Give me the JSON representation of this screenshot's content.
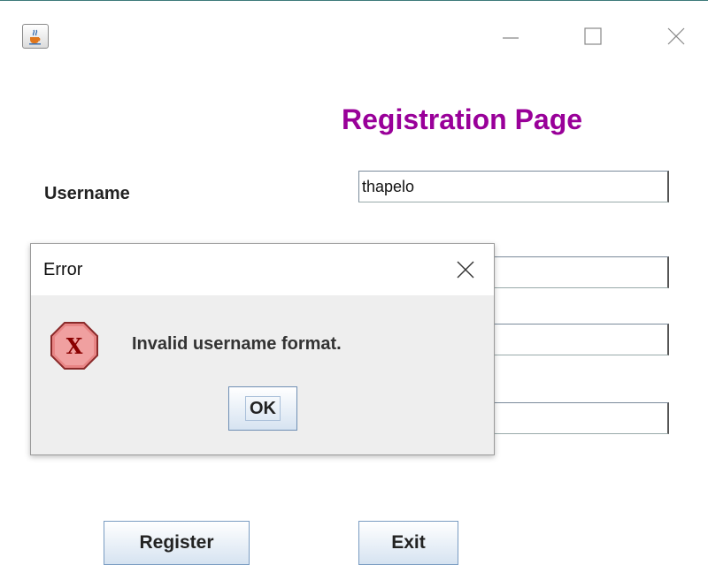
{
  "window": {
    "icon": "java-coffee-icon",
    "controls": [
      "minimize-icon",
      "maximize-icon",
      "close-icon"
    ]
  },
  "form": {
    "title": "Registration Page",
    "username_label": "Username",
    "username_value": "thapelo",
    "field2_value": "",
    "field3_value": "",
    "field4_value": "",
    "register_label": "Register",
    "exit_label": "Exit"
  },
  "dialog": {
    "title": "Error",
    "message": "Invalid username format.",
    "ok_label": "OK",
    "icon": "error-icon"
  },
  "colors": {
    "title": "#990099",
    "button_top": "#ffffff",
    "button_bottom": "#d6e3f1",
    "error_icon": "#e57373"
  }
}
